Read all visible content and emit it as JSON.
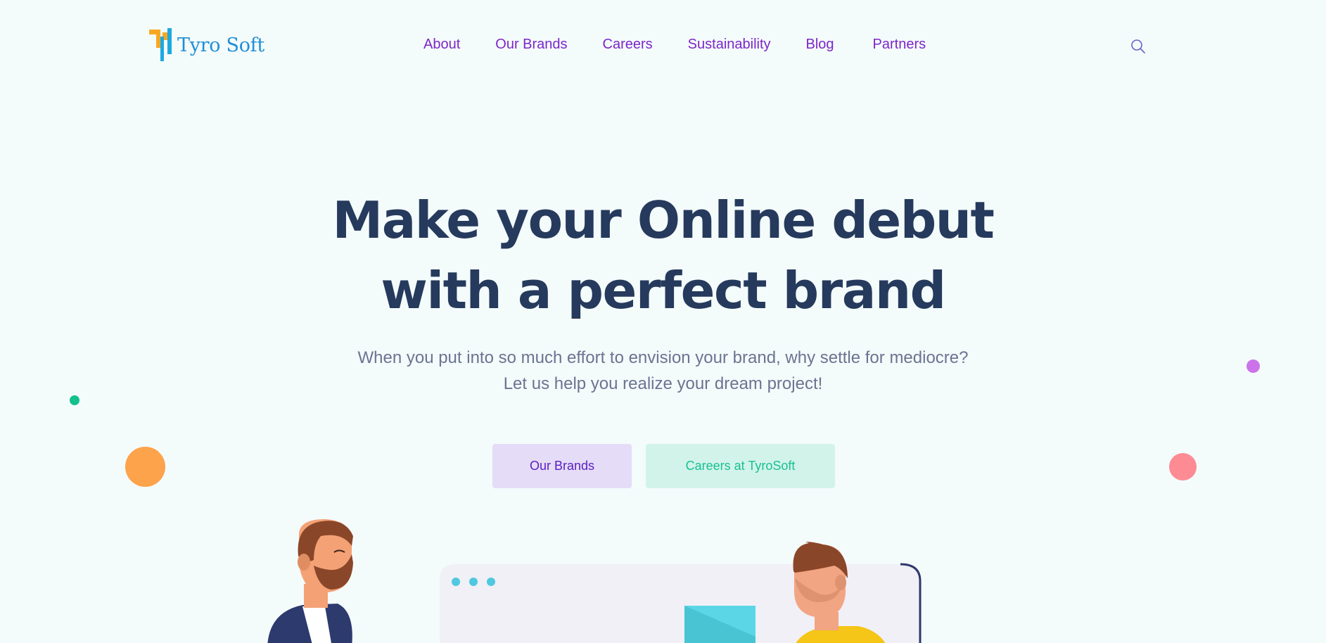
{
  "brand": {
    "name": "Tyro Soft",
    "logo_colors": [
      "#f7a823",
      "#1ea8e0"
    ]
  },
  "nav": {
    "items": [
      {
        "label": "About"
      },
      {
        "label": "Our Brands"
      },
      {
        "label": "Careers"
      },
      {
        "label": "Sustainability"
      },
      {
        "label": "Blog"
      },
      {
        "label": "Partners"
      }
    ],
    "search_icon": "search-icon"
  },
  "hero": {
    "title_line1": "Make your Online debut",
    "title_line2": "with a perfect brand",
    "subtitle_line1": "When you put into so much effort to envision your brand, why settle for mediocre?",
    "subtitle_line2": "Let us help you realize your dream project!",
    "buttons": {
      "brands_label": "Our Brands",
      "careers_label": "Careers at TyroSoft"
    }
  },
  "colors": {
    "background": "#f4fbfb",
    "nav_link": "#7c27c9",
    "heading": "#253a5c",
    "subtitle": "#6b7491",
    "brands_button_bg": "#e5dcf7",
    "brands_button_text": "#5a1fc4",
    "careers_button_bg": "#d2f3ea",
    "careers_button_text": "#18c193",
    "dots": [
      "#14c08d",
      "#fda34b",
      "#cc73ea",
      "#fd8b94"
    ]
  }
}
